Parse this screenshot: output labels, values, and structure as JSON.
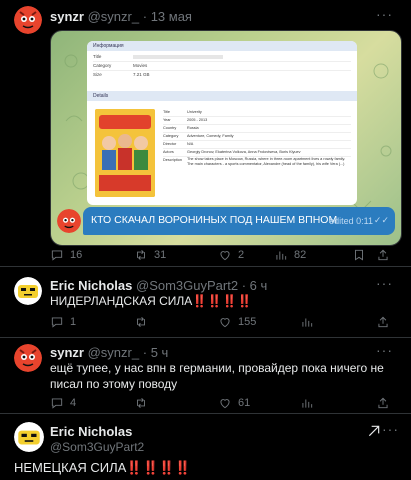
{
  "tweets": [
    {
      "name": "synzr",
      "handle": "@synzr_",
      "sep": "·",
      "date": "13 мая",
      "telegram": {
        "card_info_header": "Информация",
        "rows": [
          {
            "k": "Title",
            "v": ""
          },
          {
            "k": "Category",
            "v": "Movies"
          },
          {
            "k": "Size",
            "v": "7.21 GB"
          }
        ],
        "card_details_header": "Details",
        "details": [
          {
            "k": "Title",
            "v": "Univerity"
          },
          {
            "k": "Year",
            "v": "2005 - 2013"
          },
          {
            "k": "Country",
            "v": "Russia"
          },
          {
            "k": "Category",
            "v": "Adventure, Comedy, Family"
          },
          {
            "k": "Director",
            "v": "N/A"
          },
          {
            "k": "Actors",
            "v": "Georgiy Dronov, Ekaterina Volkova, Anna Frolovtseva, Boris Klyuev"
          },
          {
            "k": "Description",
            "v": "The show takes place in Moscow, Russia, where in three-room apartment lives a rowdy family. The main characters - a sports commentator, Alexandre (head of the family), his wife Vera (...)"
          }
        ],
        "message": "КТО СКАЧАЛ ВОРОНИНЫХ ПОД НАШЕМ ВПНОМ",
        "edited": "edited 0:11"
      },
      "stats": {
        "replies": "16",
        "retweets": "31",
        "likes": "2",
        "views": "82"
      }
    },
    {
      "name": "Eric Nicholas",
      "handle": "@Som3GuyPart2",
      "sep": "·",
      "date": "6 ч",
      "text": "НИДЕРЛАНДСКАЯ СИЛА‼️‼️‼️‼️",
      "stats": {
        "replies": "1",
        "retweets": "",
        "likes": "155",
        "views": ""
      }
    },
    {
      "name": "synzr",
      "handle": "@synzr_",
      "sep": "·",
      "date": "5 ч",
      "text": "ещё тупее, у нас впн в германии, провайдер пока ничего не писал по этому поводу",
      "stats": {
        "replies": "4",
        "retweets": "",
        "likes": "61",
        "views": ""
      }
    },
    {
      "name": "Eric Nicholas",
      "handle": "@Som3GuyPart2",
      "text": "НЕМЕЦКАЯ СИЛА‼️‼️‼️‼️"
    }
  ],
  "colors": {
    "background": "#000000",
    "muted": "#71767b",
    "telegram_bubble": "#2b7cbf"
  }
}
